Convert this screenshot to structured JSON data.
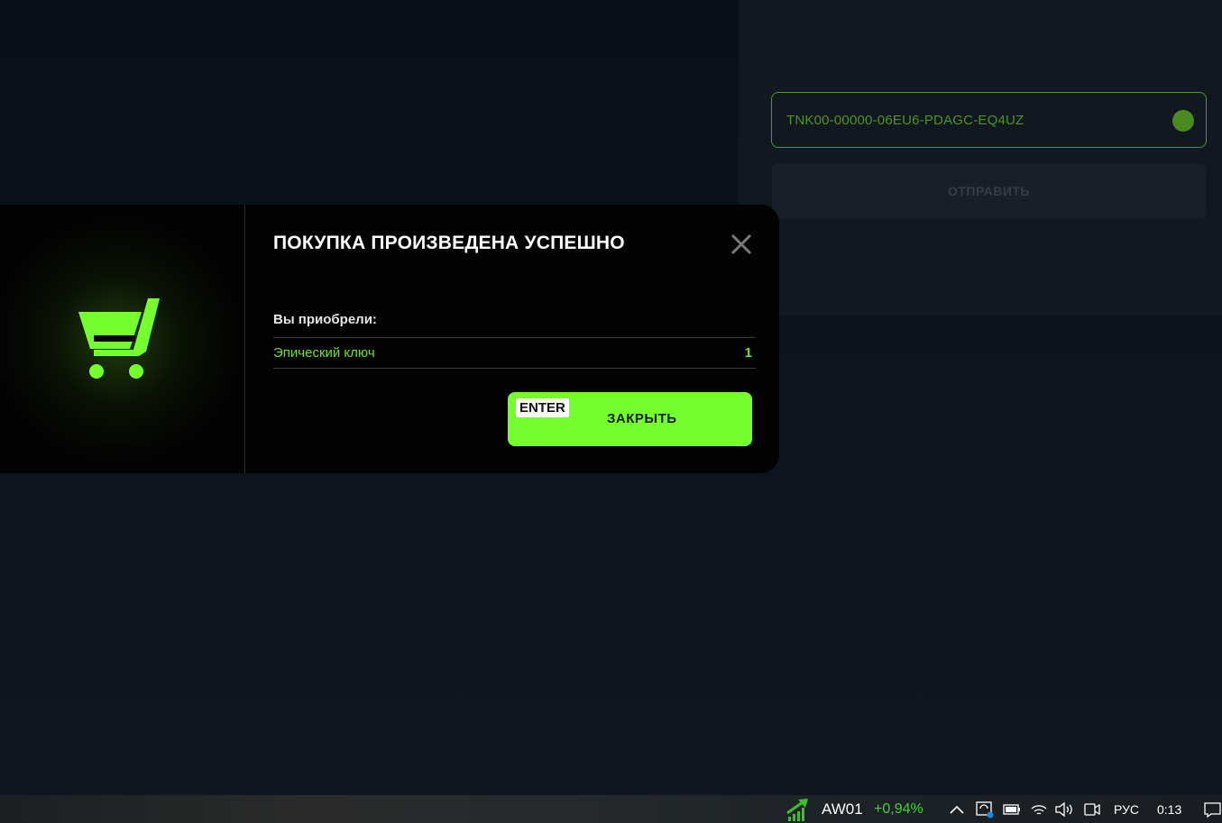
{
  "background": {
    "code_field": {
      "value": "TNK00-00000-06EU6-PDAGC-EQ4UZ",
      "status_icon": "green-dot-icon",
      "color": "#4f9324"
    },
    "send_button": {
      "label": "ОТПРАВИТЬ"
    }
  },
  "modal": {
    "title": "ПОКУПКА ПРОИЗВЕДЕНА УСПЕШНО",
    "icon": "cart-icon",
    "purchased_label": "Вы приобрели:",
    "items": [
      {
        "name": "Эпический ключ",
        "qty": "1"
      }
    ],
    "close_button": {
      "hotkey": "ENTER",
      "label": "ЗАКРЫТЬ"
    },
    "accent": "#76ff2e"
  },
  "taskbar": {
    "ticker": {
      "symbol": "AW01",
      "change": "+0,94%",
      "change_color": "#3fd43a"
    },
    "language": "РУС",
    "time": "0:13"
  }
}
